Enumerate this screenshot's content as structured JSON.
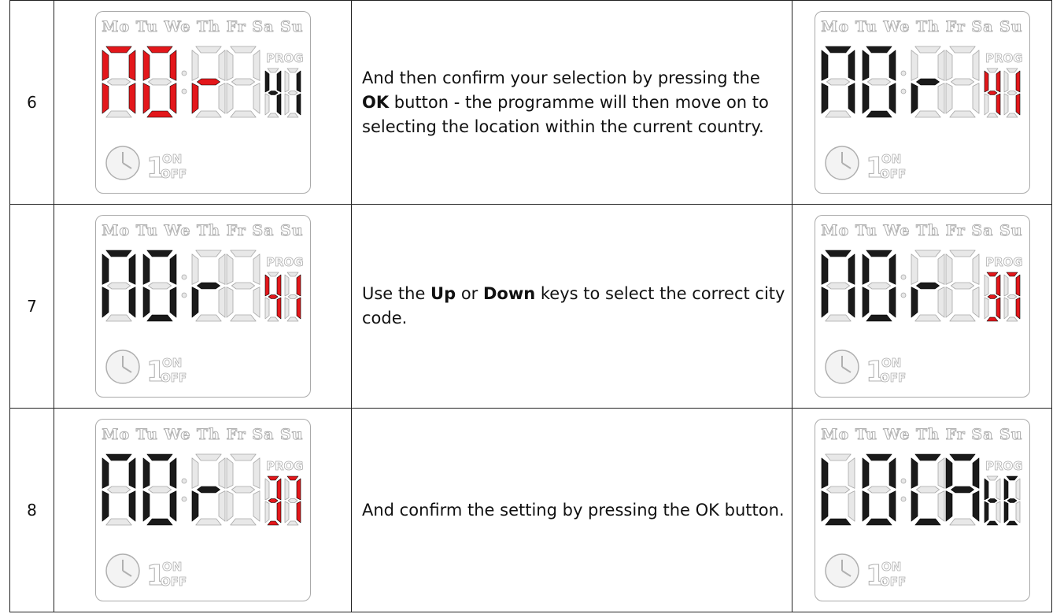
{
  "colors": {
    "active_red": "#e3171b",
    "active_black": "#1a1a1a",
    "ghost": "#e8e8e8",
    "ghost_stroke": "#a8a8a8"
  },
  "lcd_days": "MoTuWeThFrSaSu",
  "rows": [
    {
      "step": "6",
      "text_parts": [
        {
          "t": "And then confirm your selection by pressing the ",
          "b": false
        },
        {
          "t": "OK",
          "b": true
        },
        {
          "t": " button - the programme will then move on to selecting the location within the current country.",
          "b": false
        }
      ],
      "before": {
        "main": "NOr",
        "main_color": "red",
        "prog": "41",
        "prog_color": "black"
      },
      "after": {
        "main": "NOr",
        "main_color": "black",
        "prog": "41",
        "prog_color": "red"
      }
    },
    {
      "step": "7",
      "text_parts": [
        {
          "t": "Use the ",
          "b": false
        },
        {
          "t": "Up",
          "b": true
        },
        {
          "t": " or ",
          "b": false
        },
        {
          "t": "Down",
          "b": true
        },
        {
          "t": " keys to select the correct city code.",
          "b": false
        }
      ],
      "before": {
        "main": "NOr",
        "main_color": "black",
        "prog": "41",
        "prog_color": "red"
      },
      "after": {
        "main": "NOr",
        "main_color": "black",
        "prog": "37",
        "prog_color": "red"
      }
    },
    {
      "step": "8",
      "text_parts": [
        {
          "t": "And confirm the setting by pressing the OK button.",
          "b": false
        }
      ],
      "before": {
        "main": "NOr",
        "main_color": "black",
        "prog": "37",
        "prog_color": "red"
      },
      "after": {
        "main": "LOCA",
        "main_color": "black",
        "prog": "tE",
        "prog_color": "black"
      }
    }
  ]
}
